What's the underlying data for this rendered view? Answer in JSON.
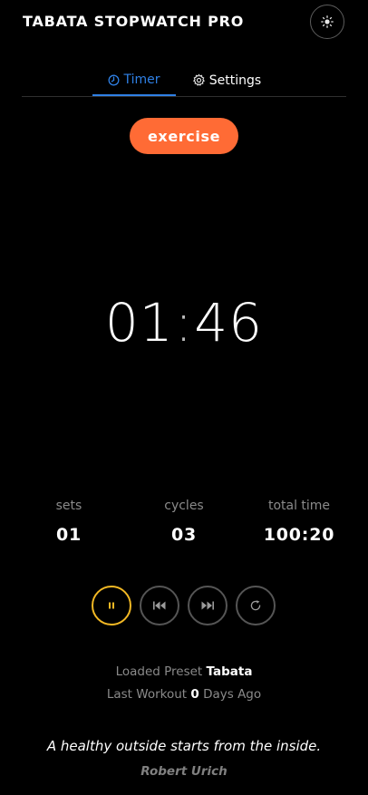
{
  "header": {
    "title": "TABATA STOPWATCH PRO",
    "theme_icon": "sun-icon"
  },
  "tabs": [
    {
      "label": "Timer",
      "icon": "clock-icon",
      "active": true
    },
    {
      "label": "Settings",
      "icon": "gear-icon",
      "active": false
    }
  ],
  "phase": {
    "label": "exercise",
    "color": "#ff6b35"
  },
  "timer": {
    "minutes": "01",
    "separator": ":",
    "seconds": "46"
  },
  "stats": [
    {
      "label": "sets",
      "value": "01"
    },
    {
      "label": "cycles",
      "value": "03"
    },
    {
      "label": "total time",
      "value": "100:20"
    }
  ],
  "controls": [
    {
      "name": "pause",
      "icon": "pause-icon",
      "active": true
    },
    {
      "name": "previous",
      "icon": "skip-back-icon",
      "active": false
    },
    {
      "name": "next",
      "icon": "skip-forward-icon",
      "active": false
    },
    {
      "name": "reset",
      "icon": "reset-icon",
      "active": false
    }
  ],
  "info": {
    "preset_prefix": "Loaded Preset",
    "preset_name": "Tabata",
    "workout_prefix": "Last Workout",
    "workout_days": "0",
    "workout_suffix": "Days Ago"
  },
  "quote": {
    "text": "A healthy outside starts from the inside.",
    "author": "Robert Urich"
  },
  "colors": {
    "accent_blue": "#2f80e5",
    "accent_orange": "#ff6b35",
    "accent_yellow": "#f2b824",
    "background": "#000000"
  }
}
